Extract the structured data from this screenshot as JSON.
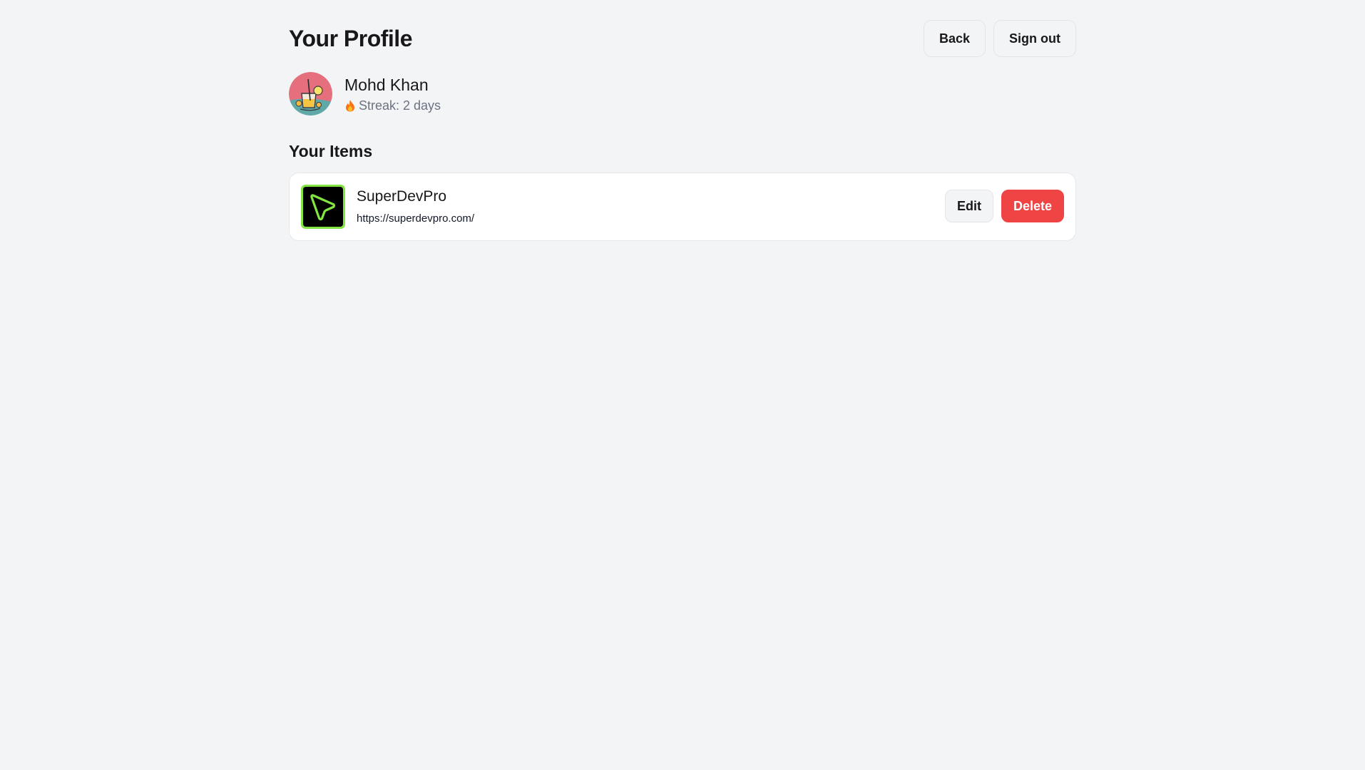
{
  "header": {
    "title": "Your Profile",
    "back_label": "Back",
    "signout_label": "Sign out"
  },
  "profile": {
    "name": "Mohd Khan",
    "streak_text": "Streak: 2 days",
    "avatar_icon": "avatar-illustration",
    "streak_icon": "fire-icon"
  },
  "items_section": {
    "title": "Your Items",
    "items": [
      {
        "name": "SuperDevPro",
        "url": "https://superdevpro.com/",
        "logo_icon": "superdevpro-logo",
        "edit_label": "Edit",
        "delete_label": "Delete"
      }
    ]
  },
  "colors": {
    "background": "#f3f4f6",
    "danger": "#ef4444",
    "logo_accent": "#84e542"
  }
}
